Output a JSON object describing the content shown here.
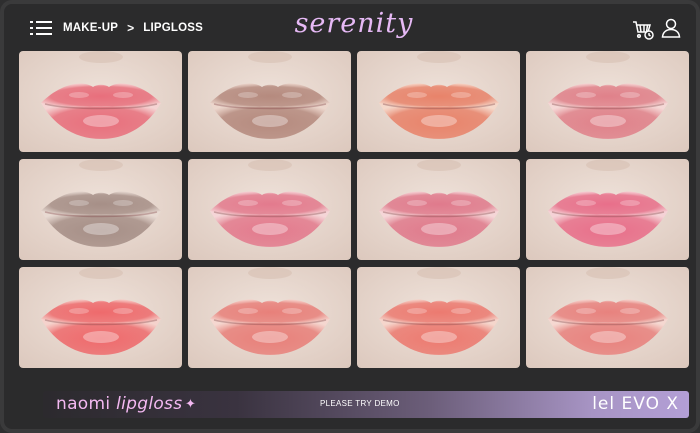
{
  "header": {
    "breadcrumb": [
      "MAKE-UP",
      "LIPGLOSS"
    ],
    "separator": ">",
    "brand": "serenity",
    "icons": {
      "menu": "menu-icon",
      "cart": "cart-clock-icon",
      "user": "user-icon"
    }
  },
  "swatches": [
    {
      "tone": "#e86f7c",
      "highlight": "#ffd3d8"
    },
    {
      "tone": "#b58a7e",
      "highlight": "#f0d6cc"
    },
    {
      "tone": "#e8836a",
      "highlight": "#ffd9c8"
    },
    {
      "tone": "#e0818a",
      "highlight": "#ffd9dc"
    },
    {
      "tone": "#a68f87",
      "highlight": "#e9dcd6"
    },
    {
      "tone": "#e37a8d",
      "highlight": "#ffd5de"
    },
    {
      "tone": "#e07a8c",
      "highlight": "#ffd6de"
    },
    {
      "tone": "#e86f8a",
      "highlight": "#ffd0dc"
    },
    {
      "tone": "#ee6a6c",
      "highlight": "#ffd0cc"
    },
    {
      "tone": "#e8807a",
      "highlight": "#ffd8d2"
    },
    {
      "tone": "#ec7a70",
      "highlight": "#ffd6cc"
    },
    {
      "tone": "#e8827e",
      "highlight": "#ffd9d4"
    }
  ],
  "banner": {
    "product_name": "naomi",
    "product_type": "lipgloss",
    "sparkle": "✦",
    "cta": "PLEASE TRY DEMO",
    "brand_tag": "lel EVO X"
  },
  "colors": {
    "background": "#2b2b2c",
    "brand": "#e6b9f5",
    "banner_text": "#f3b8f1"
  }
}
